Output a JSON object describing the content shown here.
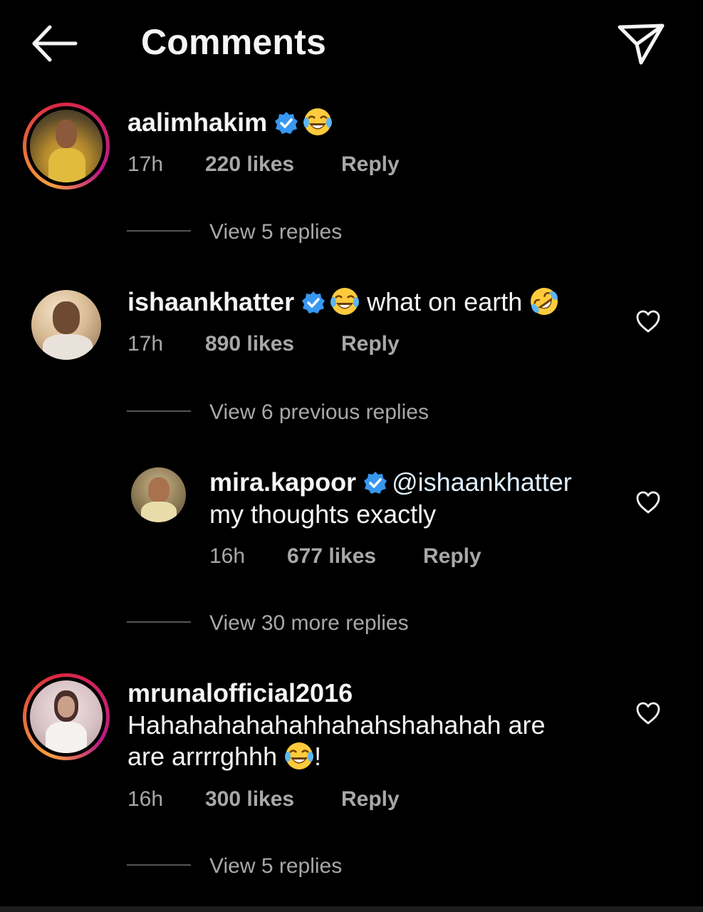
{
  "header": {
    "title": "Comments",
    "back_icon": "arrow-left-icon",
    "send_icon": "paper-plane-icon"
  },
  "colors": {
    "background": "#000000",
    "text": "#f5f5f5",
    "secondary": "#a8a8a8",
    "verified": "#3897f0",
    "ring": "#dc2743"
  },
  "comments": [
    {
      "username": "aalimhakim",
      "verified": true,
      "text_after": "",
      "time": "17h",
      "likes": "220 likes",
      "reply": "Reply",
      "view_replies": "View 5 replies"
    },
    {
      "username": "ishaankhatter",
      "verified": true,
      "text_after": "what on earth",
      "time": "17h",
      "likes": "890 likes",
      "reply": "Reply",
      "view_replies": "View 6 previous replies"
    },
    {
      "username": "mira.kapoor",
      "verified": true,
      "mention": "@ishaankhatter",
      "text_line2": "my thoughts exactly",
      "time": "16h",
      "likes": "677 likes",
      "reply": "Reply",
      "view_replies": "View 30 more replies"
    },
    {
      "username": "mrunalofficial2016",
      "verified": false,
      "text_line1": "Hahahahahahahhahahshahahah are",
      "text_line2": "are arrrrghhh",
      "text_end": "!",
      "time": "16h",
      "likes": "300 likes",
      "reply": "Reply",
      "view_replies": "View 5 replies"
    }
  ]
}
